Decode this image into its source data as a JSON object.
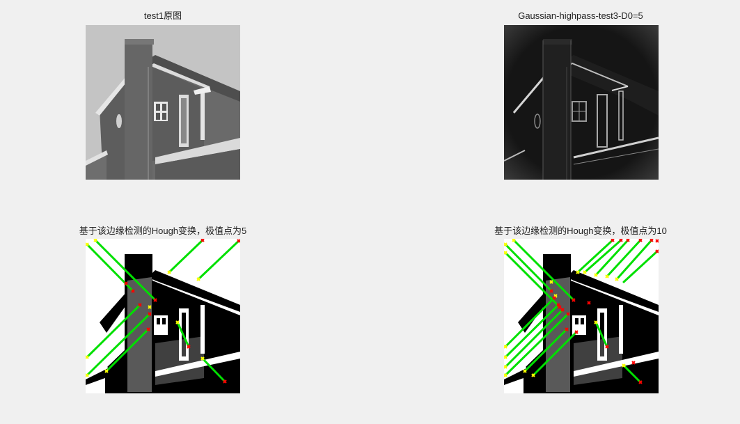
{
  "figure": {
    "panels": [
      {
        "title": "test1原图"
      },
      {
        "title": "Gaussian-highpass-test3-D0=5"
      },
      {
        "title": "基于该边缘检测的Hough变换，极值点为5"
      },
      {
        "title": "基于该边缘检测的Hough变换，极值点为10"
      }
    ]
  },
  "colors": {
    "background": "#f0f0f0",
    "hough_line": "#00e000",
    "line_start": "#ffff00",
    "line_end": "#ff0000"
  }
}
